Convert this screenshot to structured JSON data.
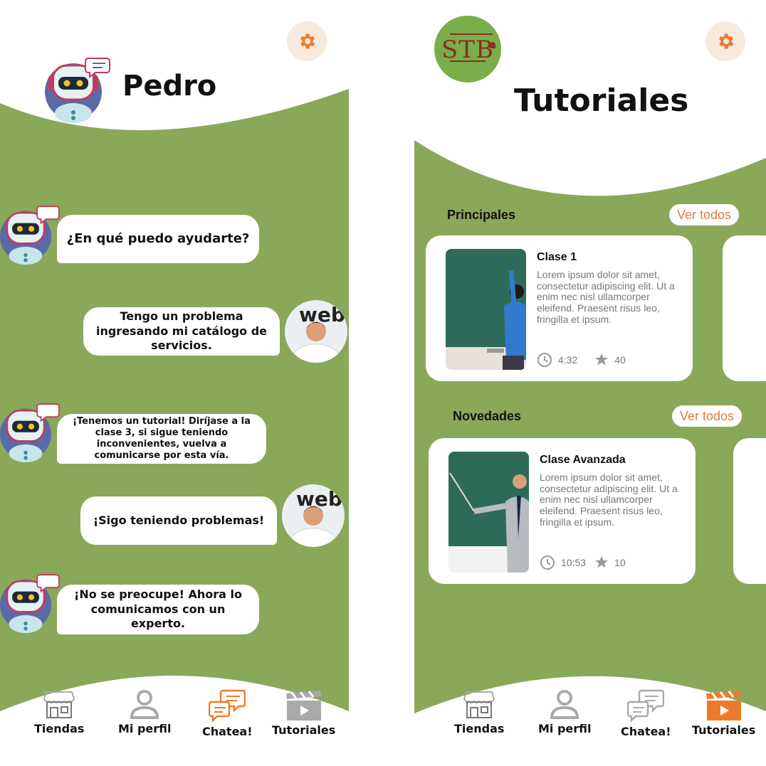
{
  "chat": {
    "bot_name": "Pedro",
    "messages": [
      {
        "from": "bot",
        "text": "¿En qué puedo ayudarte?"
      },
      {
        "from": "user",
        "text": "Tengo un problema ingresando mi catálogo de servicios."
      },
      {
        "from": "bot",
        "text": "¡Tenemos un tutorial! Diríjase a la clase 3, si sigue teniendo inconvenientes, vuelva a comunicarse por esta vía."
      },
      {
        "from": "user",
        "text": "¡Sigo teniendo problemas!"
      },
      {
        "from": "bot",
        "text": "¡No se preocupe! Ahora lo comunicamos con un experto."
      }
    ],
    "nav": {
      "active": "Chatea!"
    }
  },
  "tutorials": {
    "logo_text": "STB",
    "title": "Tutoriales",
    "sections": [
      {
        "title": "Principales",
        "see_all": "Ver todos",
        "card": {
          "title": "Clase 1",
          "description": "Lorem ipsum dolor sit amet, consectetur adipiscing elit. Ut a enim nec nisl ullamcorper eleifend. Praesent risus leo, fringilla et ipsum.",
          "duration": "4:32",
          "rating": "40"
        }
      },
      {
        "title": "Novedades",
        "see_all": "Ver todos",
        "card": {
          "title": "Clase Avanzada",
          "description": "Lorem ipsum dolor sit amet, consectetur adipiscing elit. Ut a enim nec nisl ullamcorper eleifend. Praesent risus leo, fringilla et ipsum.",
          "duration": "10:53",
          "rating": "10"
        }
      }
    ],
    "nav": {
      "active": "Tutoriales"
    }
  },
  "nav_items": [
    "Tiendas",
    "Mi perfil",
    "Chatea!",
    "Tutoriales"
  ],
  "colors": {
    "green": "#8aa85a",
    "accent": "#f07a2c",
    "gray_icon": "#a9a9a9",
    "logo_green": "#7aae4a",
    "logo_text": "#8b2e1f"
  }
}
